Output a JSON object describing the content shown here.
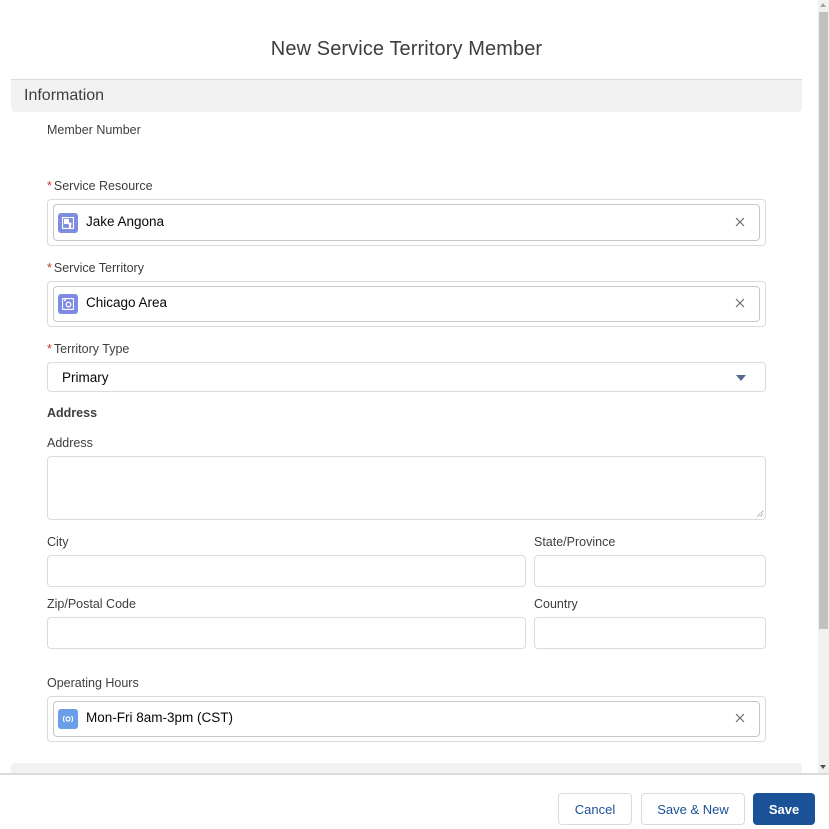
{
  "modal": {
    "title": "New Service Territory Member"
  },
  "sections": {
    "information": "Information",
    "bottom_partial": ""
  },
  "fields": {
    "member_number": {
      "label": "Member Number",
      "value": ""
    },
    "service_resource": {
      "label": "Service Resource",
      "required": "*",
      "value": "Jake Angona",
      "icon": "service-resource-icon",
      "icon_color": "#7f8de1"
    },
    "service_territory": {
      "label": "Service Territory",
      "required": "*",
      "value": "Chicago Area",
      "icon": "service-territory-icon",
      "icon_color": "#7e8be4"
    },
    "territory_type": {
      "label": "Territory Type",
      "required": "*",
      "value": "Primary"
    },
    "address_group": {
      "label": "Address"
    },
    "address": {
      "label": "Address",
      "value": ""
    },
    "city": {
      "label": "City",
      "value": ""
    },
    "state": {
      "label": "State/Province",
      "value": ""
    },
    "zip": {
      "label": "Zip/Postal Code",
      "value": ""
    },
    "country": {
      "label": "Country",
      "value": ""
    },
    "operating_hours": {
      "label": "Operating Hours",
      "value": "Mon-Fri 8am-3pm (CST)",
      "icon": "operating-hours-icon",
      "icon_color": "#6b9ee8"
    }
  },
  "footer": {
    "cancel_label": "Cancel",
    "save_new_label": "Save & New",
    "save_label": "Save"
  },
  "colors": {
    "brand": "#1b5297",
    "required": "#c23934",
    "section_bg": "#f3f2f2"
  }
}
